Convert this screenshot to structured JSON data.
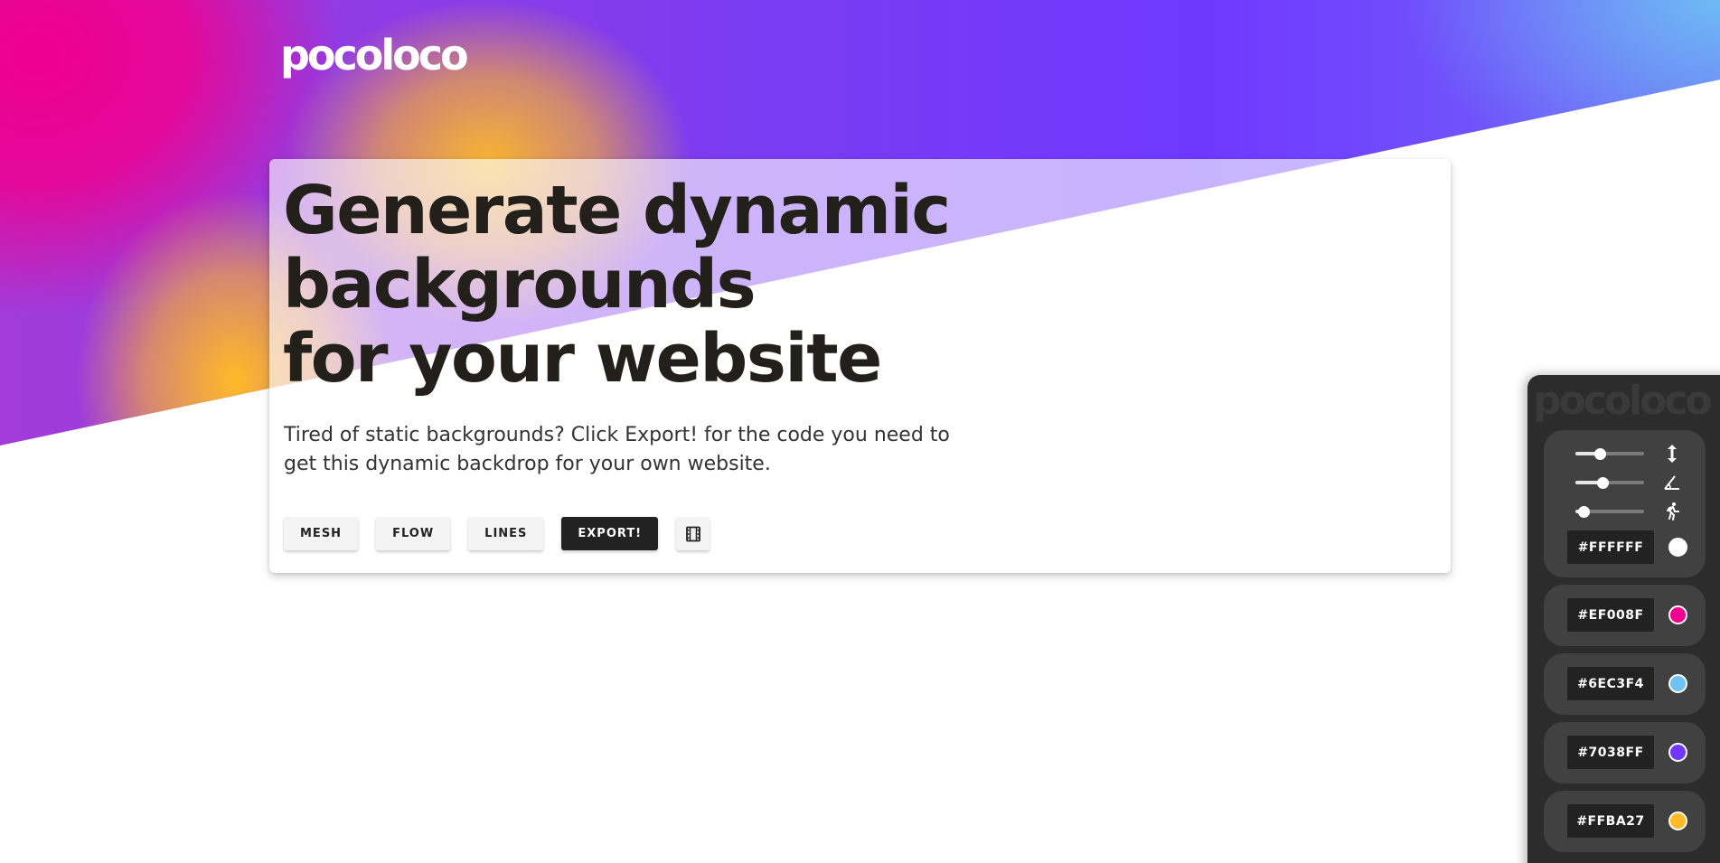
{
  "brand": {
    "logo": "pocoloco"
  },
  "hero": {
    "headline": "Generate dynamic\nbackgrounds\nfor your website",
    "subtext": "Tired of static backgrounds? Click Export! for the code you need to get this dynamic backdrop for your own website.",
    "buttons": {
      "mesh": "MESH",
      "flow": "FLOW",
      "lines": "LINES",
      "export": "EXPORT!",
      "film_icon": "film-icon"
    }
  },
  "panel": {
    "logo": "pocoloco",
    "sliders": [
      {
        "icon": "vertical-arrows-icon",
        "value": 0.36
      },
      {
        "icon": "angle-icon",
        "value": 0.39
      },
      {
        "icon": "running-person-icon",
        "value": 0.12
      }
    ],
    "colors": [
      {
        "hex": "#FFFFFF",
        "swatch": "#FFFFFF"
      },
      {
        "hex": "#EF008F",
        "swatch": "#EF008F"
      },
      {
        "hex": "#6EC3F4",
        "swatch": "#6EC3F4"
      },
      {
        "hex": "#7038FF",
        "swatch": "#7038FF"
      },
      {
        "hex": "#FFBA27",
        "swatch": "#FFBA27"
      }
    ]
  }
}
